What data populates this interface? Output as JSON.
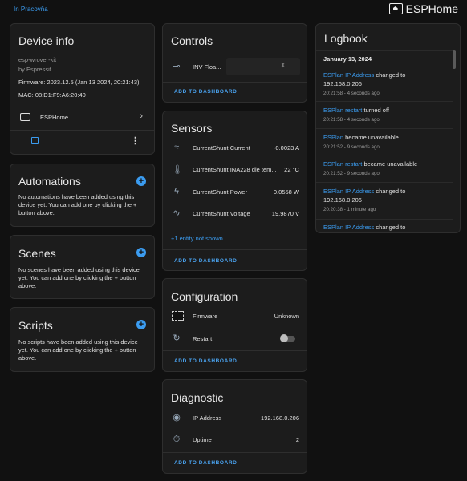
{
  "header": {
    "area": "In Pracovňa",
    "brand": "ESPHome"
  },
  "device_info": {
    "title": "Device info",
    "model": "esp-wrover-kit",
    "manufacturer": "by Espressif",
    "firmware": "Firmware: 2023.12.5 (Jan 13 2024, 20:21:43)",
    "mac": "MAC: 08:D1:F9:A6:20:40",
    "integration": "ESPHome"
  },
  "automations": {
    "title": "Automations",
    "text": "No automations have been added using this device yet. You can add one by clicking the + button above."
  },
  "scenes": {
    "title": "Scenes",
    "text": "No scenes have been added using this device yet. You can add one by clicking the + button above."
  },
  "scripts": {
    "title": "Scripts",
    "text": "No scripts have been added using this device yet. You can add one by clicking the + button above."
  },
  "controls": {
    "title": "Controls",
    "item_label": "INV Floa...",
    "action": "ADD TO DASHBOARD"
  },
  "sensors": {
    "title": "Sensors",
    "rows": [
      {
        "label": "CurrentShunt Current",
        "value": "-0.0023 A"
      },
      {
        "label": "CurrentShunt INA228 die tem...",
        "value": "22 °C"
      },
      {
        "label": "CurrentShunt Power",
        "value": "0.0558 W"
      },
      {
        "label": "CurrentShunt Voltage",
        "value": "19.9870 V"
      }
    ],
    "more": "+1 entity not shown",
    "action": "ADD TO DASHBOARD"
  },
  "configuration": {
    "title": "Configuration",
    "rows": [
      {
        "label": "Firmware",
        "value": "Unknown"
      },
      {
        "label": "Restart",
        "value": ""
      }
    ],
    "action": "ADD TO DASHBOARD"
  },
  "diagnostic": {
    "title": "Diagnostic",
    "rows": [
      {
        "label": "IP Address",
        "value": "192.168.0.206"
      },
      {
        "label": "Uptime",
        "value": "2"
      }
    ],
    "action": "ADD TO DASHBOARD"
  },
  "logbook": {
    "title": "Logbook",
    "date": "January 13, 2024",
    "entries": [
      {
        "entity": "ESPlan IP Address",
        "text": " changed to",
        "detail": "192.168.0.206",
        "time": "20:21:58 - 4 seconds ago"
      },
      {
        "entity": "ESPlan restart",
        "text": " turned off",
        "detail": "",
        "time": "20:21:58 - 4 seconds ago"
      },
      {
        "entity": "ESPlan",
        "text": " became unavailable",
        "detail": "",
        "time": "20:21:52 - 9 seconds ago"
      },
      {
        "entity": "ESPlan restart",
        "text": " became unavailable",
        "detail": "",
        "time": "20:21:52 - 9 seconds ago"
      },
      {
        "entity": "ESPlan IP Address",
        "text": " changed to",
        "detail": "192.168.0.206",
        "time": "20:20:38 - 1 minute ago"
      },
      {
        "entity": "ESPlan IP Address",
        "text": " changed to",
        "detail": "",
        "time": ""
      }
    ]
  }
}
